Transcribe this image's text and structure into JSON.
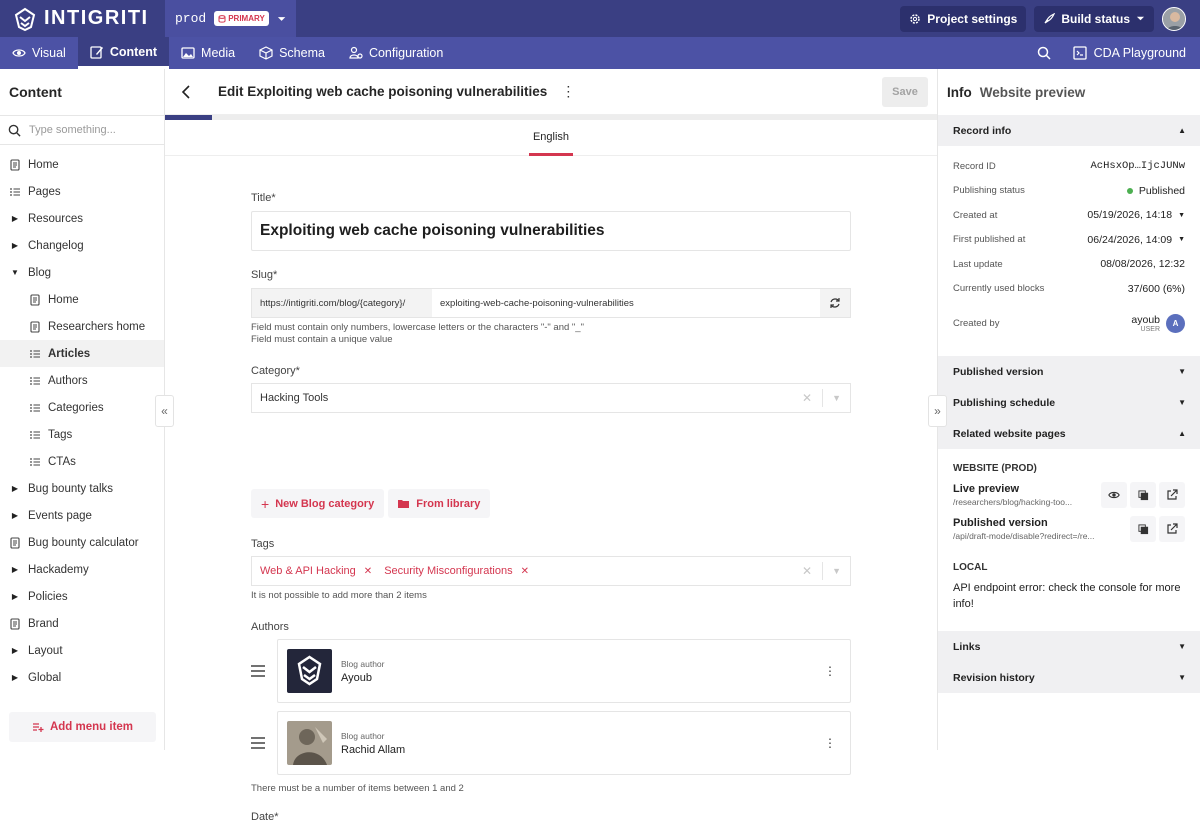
{
  "brand": {
    "name": "INTIGRITI"
  },
  "env": {
    "name": "prod",
    "badge": "PRIMARY"
  },
  "topbar": {
    "project_settings": "Project settings",
    "build_status": "Build status"
  },
  "tabs": [
    {
      "label": "Visual",
      "icon": "eye-icon"
    },
    {
      "label": "Content",
      "icon": "edit-icon"
    },
    {
      "label": "Media",
      "icon": "image-icon"
    },
    {
      "label": "Schema",
      "icon": "cube-icon"
    },
    {
      "label": "Configuration",
      "icon": "configuration-icon"
    }
  ],
  "tabbar_right": {
    "playground": "CDA Playground"
  },
  "sidebar": {
    "title": "Content",
    "search_placeholder": "Type something...",
    "items": [
      {
        "label": "Home",
        "icon": "page"
      },
      {
        "label": "Pages",
        "icon": "list"
      },
      {
        "label": "Resources",
        "icon": "tri-right"
      },
      {
        "label": "Changelog",
        "icon": "tri-right"
      },
      {
        "label": "Blog",
        "icon": "tri-down"
      },
      {
        "label": "Home",
        "icon": "page",
        "child": true
      },
      {
        "label": "Researchers home",
        "icon": "page",
        "child": true
      },
      {
        "label": "Articles",
        "icon": "list",
        "child": true,
        "active": true
      },
      {
        "label": "Authors",
        "icon": "list",
        "child": true
      },
      {
        "label": "Categories",
        "icon": "list",
        "child": true
      },
      {
        "label": "Tags",
        "icon": "list",
        "child": true
      },
      {
        "label": "CTAs",
        "icon": "list",
        "child": true
      },
      {
        "label": "Bug bounty talks",
        "icon": "tri-right"
      },
      {
        "label": "Events page",
        "icon": "tri-right"
      },
      {
        "label": "Bug bounty calculator",
        "icon": "page"
      },
      {
        "label": "Hackademy",
        "icon": "tri-right"
      },
      {
        "label": "Policies",
        "icon": "tri-right"
      },
      {
        "label": "Brand",
        "icon": "page"
      },
      {
        "label": "Layout",
        "icon": "tri-right"
      },
      {
        "label": "Global",
        "icon": "tri-right"
      }
    ],
    "add_menu_item": "Add menu item"
  },
  "editor": {
    "title": "Edit Exploiting web cache poisoning vulnerabilities",
    "save": "Save",
    "locale": "English",
    "fields": {
      "title_label": "Title*",
      "title_value": "Exploiting web cache poisoning vulnerabilities",
      "slug_label": "Slug*",
      "slug_prefix": "https://intigriti.com/blog/{category}/",
      "slug_value": "exploiting-web-cache-poisoning-vulnerabilities",
      "slug_help1": "Field must contain only numbers, lowercase letters or the characters \"-\" and \"_\"",
      "slug_help2": "Field must contain a unique value",
      "category_label": "Category*",
      "category_value": "Hacking Tools",
      "new_category": "New Blog category",
      "from_library": "From library",
      "tags_label": "Tags",
      "tags": [
        "Web & API Hacking",
        "Security Misconfigurations"
      ],
      "tags_help": "It is not possible to add more than 2 items",
      "authors_label": "Authors",
      "authors": [
        {
          "caption": "Blog author",
          "name": "Ayoub"
        },
        {
          "caption": "Blog author",
          "name": "Rachid Allam"
        }
      ],
      "authors_help": "There must be a number of items between 1 and 2",
      "date_label": "Date*"
    }
  },
  "info": {
    "tab_info": "Info",
    "tab_preview": "Website preview",
    "record_info": "Record info",
    "rows": [
      {
        "k": "Record ID",
        "v": "AcHsxOp…IjcJUNw"
      },
      {
        "k": "Publishing status",
        "v": "Published"
      },
      {
        "k": "Created at",
        "v": "05/19/2026, 14:18"
      },
      {
        "k": "First published at",
        "v": "06/24/2026, 14:09"
      },
      {
        "k": "Last update",
        "v": "08/08/2026, 12:32"
      },
      {
        "k": "Currently used blocks",
        "v": "37/600 (6%)"
      }
    ],
    "created_by_label": "Created by",
    "created_by_name": "ayoub",
    "created_by_role": "USER",
    "created_by_initial": "A",
    "published_version": "Published version",
    "publishing_schedule": "Publishing schedule",
    "related_pages": "Related website pages",
    "website_prod": "WEBSITE (PROD)",
    "live_preview": "Live preview",
    "live_preview_url": "/researchers/blog/hacking-too...",
    "published_version_link": "Published version",
    "published_version_url": "/api/draft-mode/disable?redirect=/re...",
    "local": "LOCAL",
    "api_error": "API endpoint error: check the console for more info!",
    "links": "Links",
    "revision_history": "Revision history"
  },
  "colors": {
    "brand": "#3a3f83",
    "accent": "#d4364f",
    "status_published": "#4caf50"
  }
}
